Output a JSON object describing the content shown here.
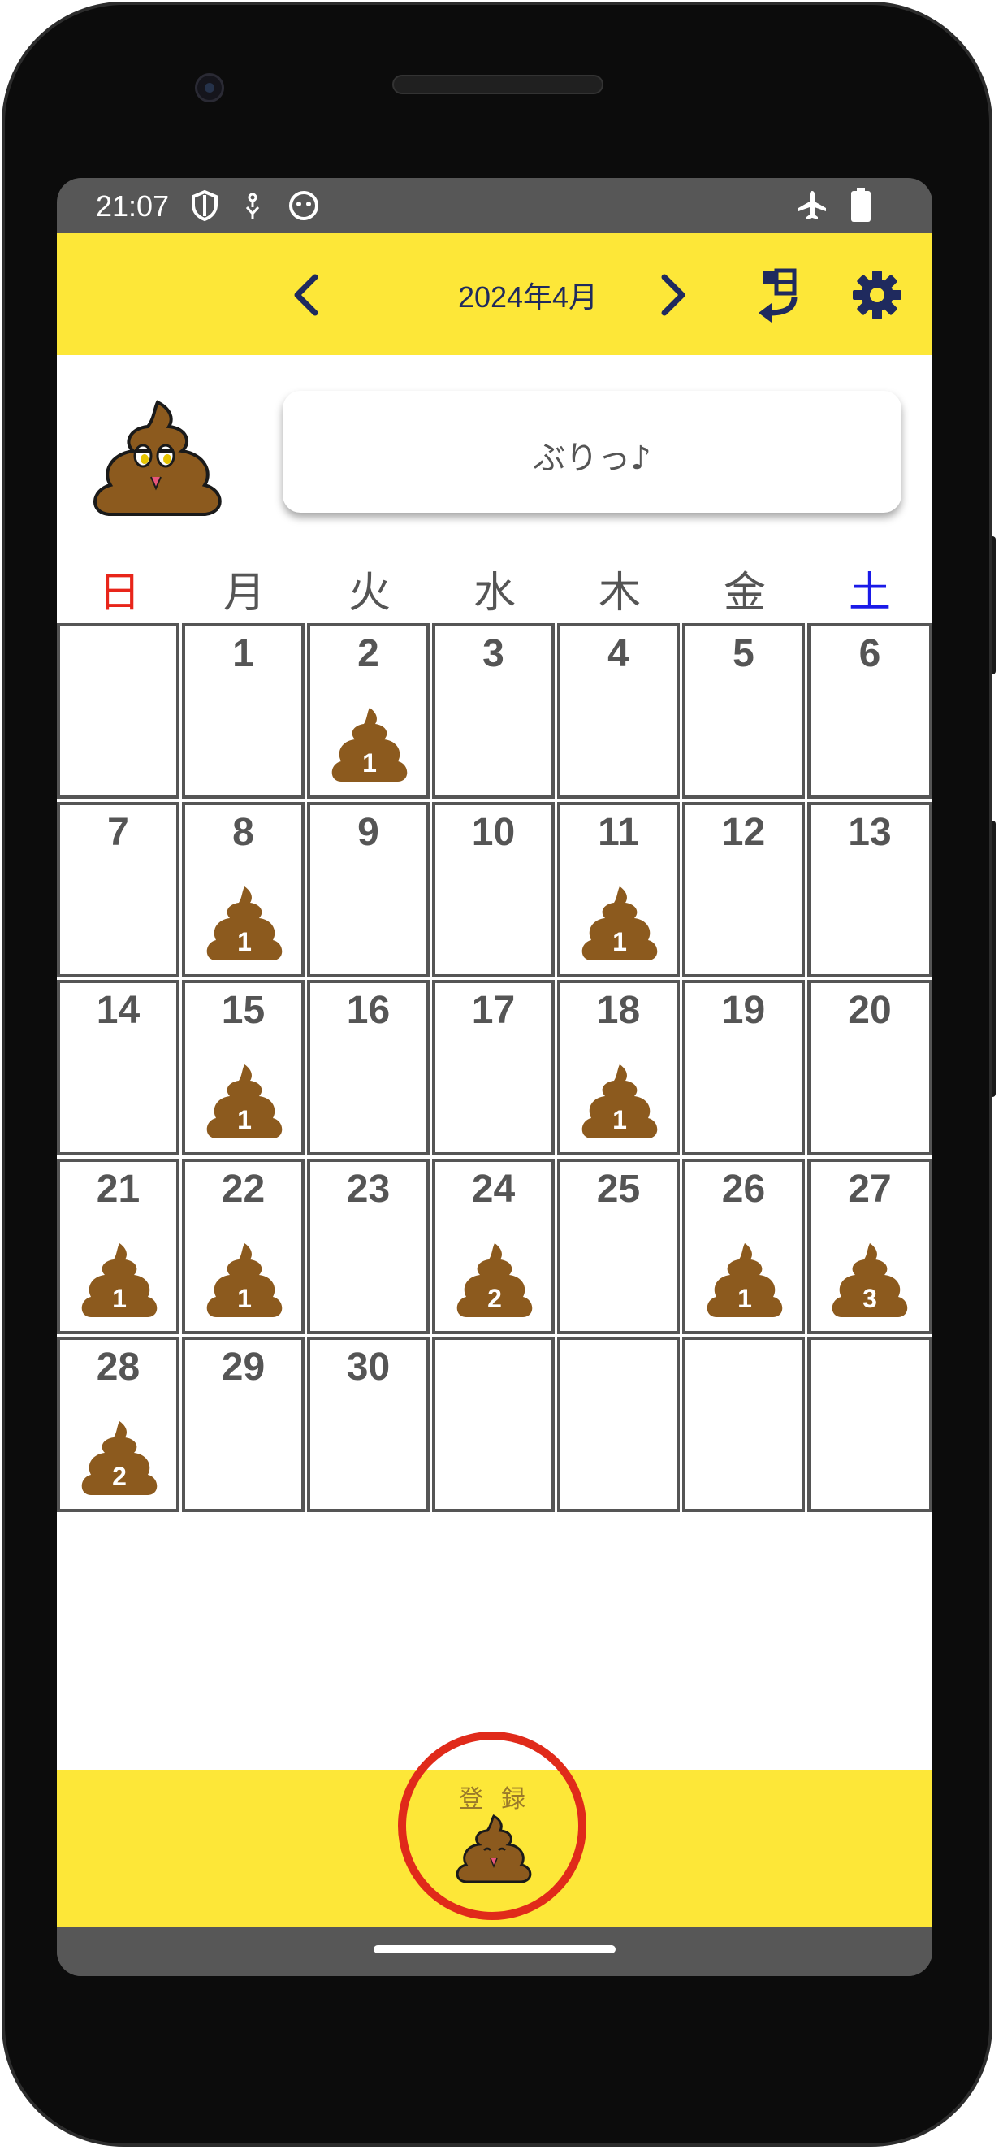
{
  "status": {
    "time": "21:07"
  },
  "header": {
    "month_title": "2024年4月"
  },
  "bubble": {
    "text": "ぶりっ♪"
  },
  "weekdays": [
    "日",
    "月",
    "火",
    "水",
    "木",
    "金",
    "土"
  ],
  "colors": {
    "accent_yellow": "#fde738",
    "poop_brown": "#8c5a1e",
    "sunday_red": "#e8251a",
    "saturday_blue": "#1a1ae8",
    "register_ring": "#e02a1a",
    "nav_navy": "#1f2a5e"
  },
  "calendar": {
    "days": [
      {
        "day": "",
        "count": ""
      },
      {
        "day": "1",
        "count": ""
      },
      {
        "day": "2",
        "count": "1"
      },
      {
        "day": "3",
        "count": ""
      },
      {
        "day": "4",
        "count": ""
      },
      {
        "day": "5",
        "count": ""
      },
      {
        "day": "6",
        "count": ""
      },
      {
        "day": "7",
        "count": ""
      },
      {
        "day": "8",
        "count": "1"
      },
      {
        "day": "9",
        "count": ""
      },
      {
        "day": "10",
        "count": ""
      },
      {
        "day": "11",
        "count": "1"
      },
      {
        "day": "12",
        "count": ""
      },
      {
        "day": "13",
        "count": ""
      },
      {
        "day": "14",
        "count": ""
      },
      {
        "day": "15",
        "count": "1"
      },
      {
        "day": "16",
        "count": ""
      },
      {
        "day": "17",
        "count": ""
      },
      {
        "day": "18",
        "count": "1"
      },
      {
        "day": "19",
        "count": ""
      },
      {
        "day": "20",
        "count": ""
      },
      {
        "day": "21",
        "count": "1"
      },
      {
        "day": "22",
        "count": "1"
      },
      {
        "day": "23",
        "count": ""
      },
      {
        "day": "24",
        "count": "2"
      },
      {
        "day": "25",
        "count": ""
      },
      {
        "day": "26",
        "count": "1"
      },
      {
        "day": "27",
        "count": "3"
      },
      {
        "day": "28",
        "count": "2"
      },
      {
        "day": "29",
        "count": ""
      },
      {
        "day": "30",
        "count": ""
      },
      {
        "day": "",
        "count": ""
      },
      {
        "day": "",
        "count": ""
      },
      {
        "day": "",
        "count": ""
      },
      {
        "day": "",
        "count": ""
      }
    ]
  },
  "register": {
    "label": "登録"
  },
  "icons": {
    "prev": "chevron-left-icon",
    "next": "chevron-right-icon",
    "today": "today-return-icon",
    "settings": "gear-icon"
  }
}
